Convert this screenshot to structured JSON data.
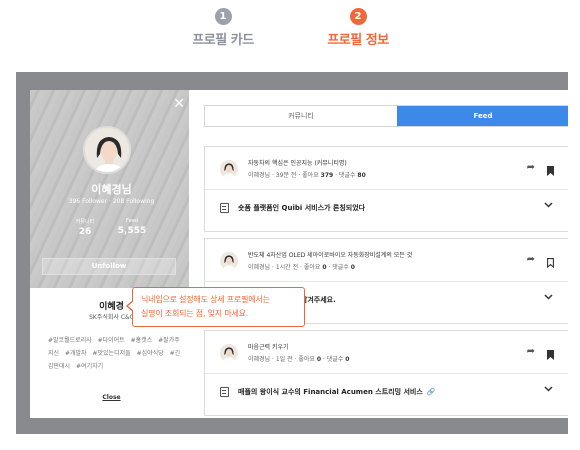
{
  "steps": [
    {
      "num": "1",
      "label": "프로필 카드"
    },
    {
      "num": "2",
      "label": "프로필 정보"
    }
  ],
  "profile": {
    "nickname": "이혜경님",
    "followers": "396 Follower",
    "following": "208 Following",
    "stats": [
      {
        "label": "커뮤니티",
        "value": "26"
      },
      {
        "label": "Feed",
        "value": "5,555"
      }
    ],
    "unfollow_label": "Unfollow",
    "real_name": "이혜경",
    "company": "SK주식회사 C&C",
    "tags": [
      "#말코뭘드로리사",
      "#다이어트",
      "#홈캣스",
      "#팔가주지신",
      "#개발자",
      "#맛있는디저들",
      "#심야식당",
      "#긴갑판대시",
      "#여기자기"
    ],
    "close_label": "Close"
  },
  "tabs": {
    "community": "커뮤니티",
    "feed": "Feed"
  },
  "posts": [
    {
      "title": "자동차의 핵심은 인공지능 (커뮤니티명)",
      "author": "이혜경님",
      "time": "39분 전",
      "likes_label": "좋아요",
      "likes": "379",
      "comments_label": "댓글수",
      "comments": "80",
      "content_title": "숏폼 플랫폼인 Quibi 서비스가 론칭되었다",
      "bookmarked": true
    },
    {
      "title": "반도체 4차산업 OLED 세아이로바이오 자동화장비설계의 모든 것",
      "author": "이혜경님",
      "time": "1시간 전",
      "likes_label": "좋아요",
      "likes": "0",
      "comments_label": "댓글수",
      "comments": "0",
      "content_title": "요? 자유로운 의견을 남겨주세요.",
      "bookmarked": false
    },
    {
      "title": "마음근력 키우기",
      "author": "이혜경님",
      "time": "1일 전",
      "likes_label": "좋아요",
      "likes": "0",
      "comments_label": "댓글수",
      "comments": "0",
      "content_title": "매플의 왕이식 교수의 Financial Acumen 스트리밍 서비스",
      "bookmarked": true
    }
  ],
  "tooltip": {
    "line1": "닉네임으로 설정해도 상세 프로필에서는",
    "line2": "실명이 조회되는 점, 잊지 마세요."
  },
  "colors": {
    "accent": "#f0683a",
    "tab_active": "#3c89e8",
    "step_inactive": "#9aa2ad"
  }
}
